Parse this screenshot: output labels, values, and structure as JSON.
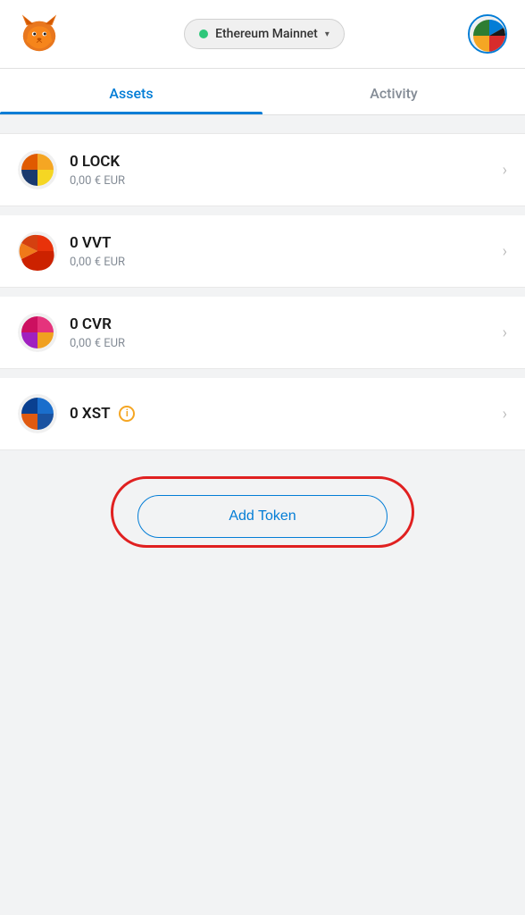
{
  "header": {
    "network_name": "Ethereum Mainnet",
    "network_status": "connected",
    "network_dot_color": "#2ec77a"
  },
  "tabs": [
    {
      "id": "assets",
      "label": "Assets",
      "active": true
    },
    {
      "id": "activity",
      "label": "Activity",
      "active": false
    }
  ],
  "assets": [
    {
      "symbol": "LOCK",
      "amount": "0 LOCK",
      "value": "0,00 € EUR",
      "icon": "lock"
    },
    {
      "symbol": "VVT",
      "amount": "0 VVT",
      "value": "0,00 € EUR",
      "icon": "vvt"
    },
    {
      "symbol": "CVR",
      "amount": "0 CVR",
      "value": "0,00 € EUR",
      "icon": "cvr"
    },
    {
      "symbol": "XST",
      "amount": "0 XST",
      "value": "",
      "icon": "xst",
      "has_info": true
    }
  ],
  "add_token": {
    "label": "Add Token"
  }
}
